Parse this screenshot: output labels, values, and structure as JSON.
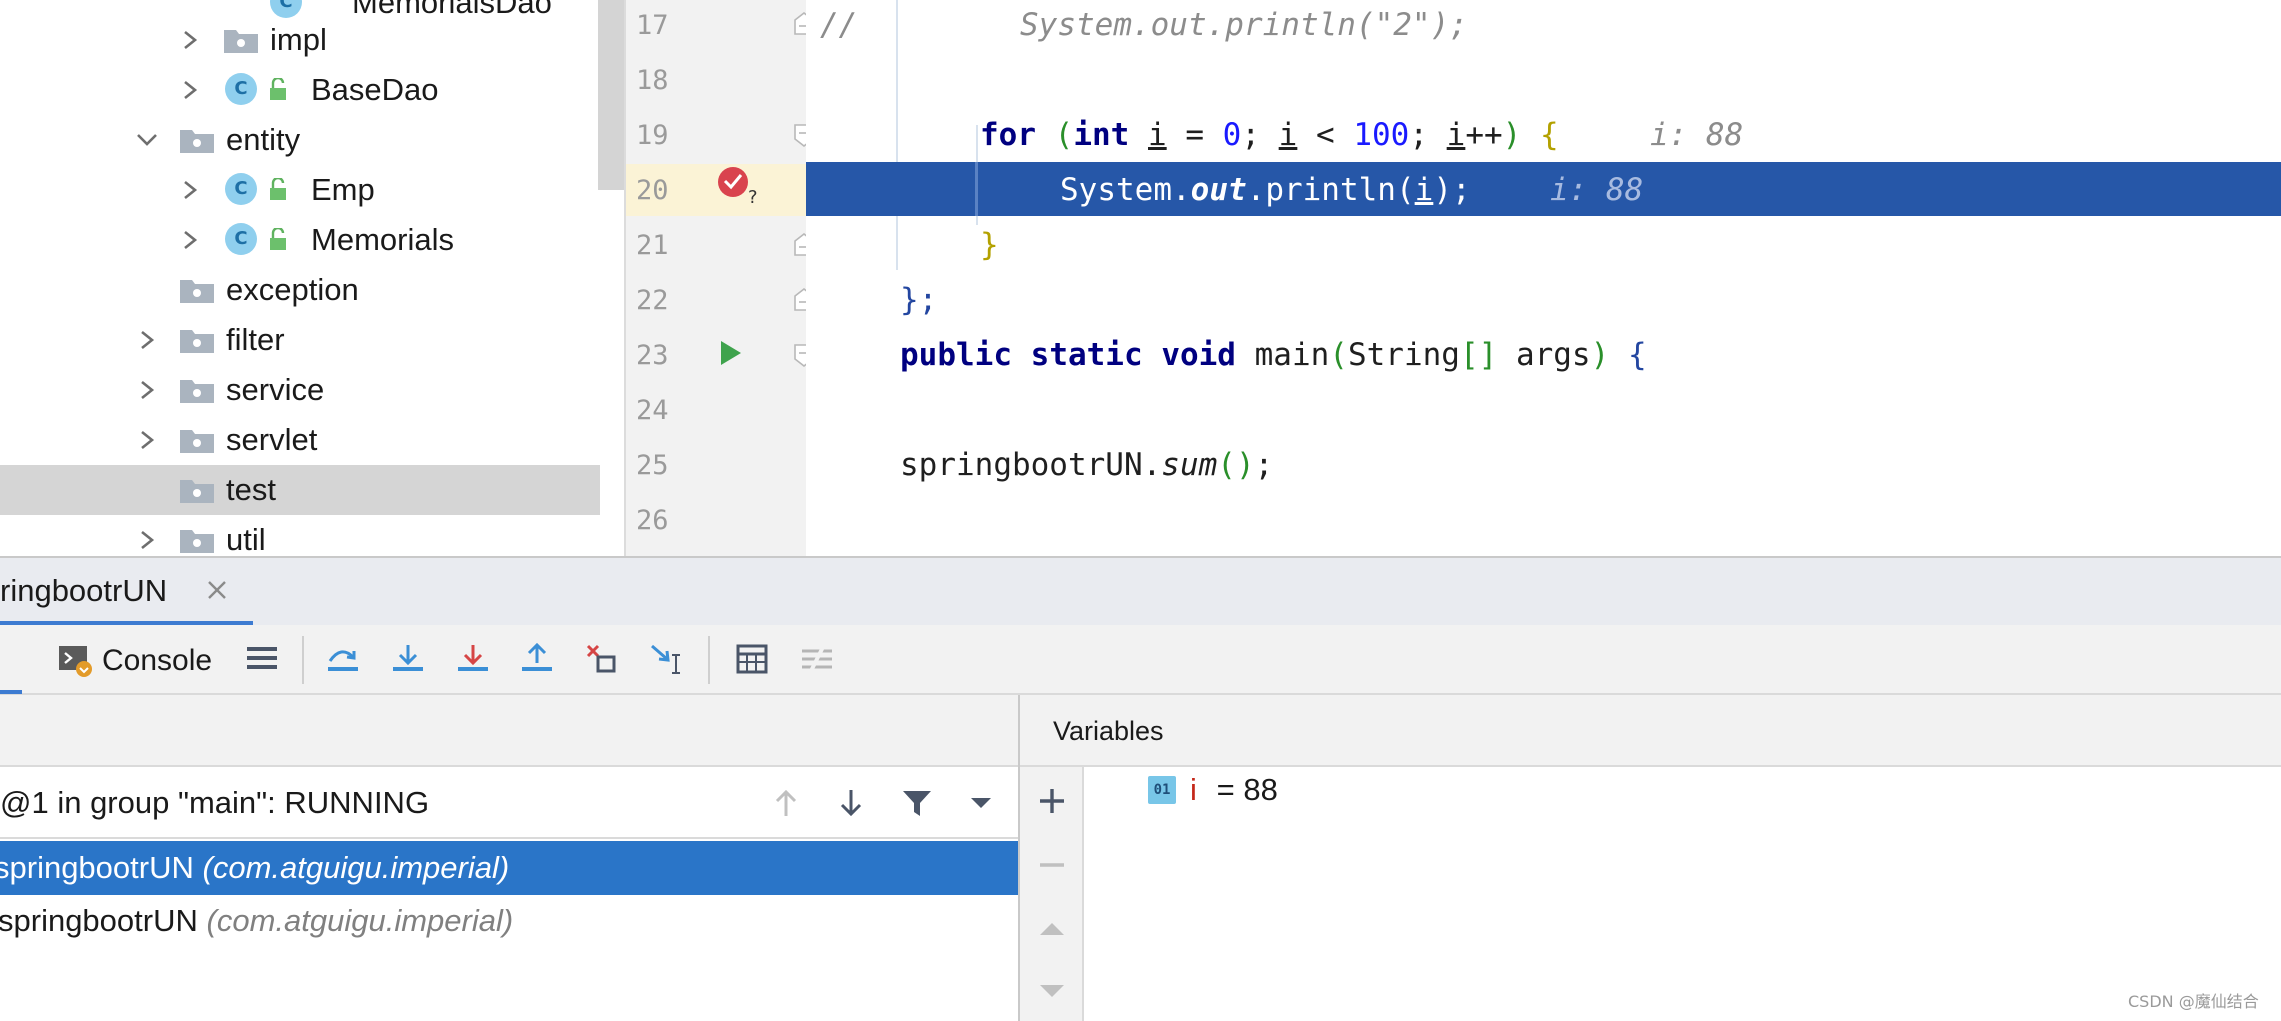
{
  "project_tree": {
    "items": [
      {
        "label": "MemorialsDao",
        "kind": "class",
        "expandable": false
      },
      {
        "label": "impl",
        "kind": "folder",
        "expandable": true
      },
      {
        "label": "BaseDao",
        "kind": "class",
        "expandable": true
      },
      {
        "label": "entity",
        "kind": "folder",
        "expandable": true,
        "expanded": true
      },
      {
        "label": "Emp",
        "kind": "class",
        "expandable": true
      },
      {
        "label": "Memorials",
        "kind": "class",
        "expandable": true
      },
      {
        "label": "exception",
        "kind": "folder",
        "expandable": false
      },
      {
        "label": "filter",
        "kind": "folder",
        "expandable": true
      },
      {
        "label": "service",
        "kind": "folder",
        "expandable": true
      },
      {
        "label": "servlet",
        "kind": "folder",
        "expandable": true
      },
      {
        "label": "test",
        "kind": "folder",
        "expandable": false,
        "selected": true
      },
      {
        "label": "util",
        "kind": "folder",
        "expandable": true
      }
    ],
    "class_badge": "C"
  },
  "editor": {
    "line_numbers": [
      "17",
      "18",
      "19",
      "20",
      "21",
      "22",
      "23",
      "24",
      "25",
      "26"
    ],
    "current_line": "20",
    "lines": {
      "l17_comment_mark": "//",
      "l17_code": "System.out.println(\"2\");",
      "l19_for": "for",
      "l19_open": " (",
      "l19_int": "int",
      "l19_i1": "i",
      "l19_eq": " = ",
      "l19_zero": "0",
      "l19_semi1": "; ",
      "l19_i2": "i",
      "l19_lt": " < ",
      "l19_hundred": "100",
      "l19_semi2": "; ",
      "l19_i3": "i",
      "l19_inc": "++",
      "l19_close": ") ",
      "l19_brace": "{",
      "l19_hint": "i: 88",
      "l20_system": "System.",
      "l20_out": "out",
      "l20_println": ".println(",
      "l20_i": "i",
      "l20_end": ");",
      "l20_hint": "i: 88",
      "l21_brace": "}",
      "l22_code": "};",
      "l23_public": "public",
      "l23_static": "static",
      "l23_void": "void",
      "l23_main": "main",
      "l23_paren_open": "(",
      "l23_string": "String",
      "l23_arr": "[]",
      "l23_args": " args",
      "l23_paren_close": ")",
      "l23_brace": "{",
      "l25_obj": "springbootrUN.",
      "l25_sum": "sum",
      "l25_parens": "()",
      "l25_semi": ";"
    }
  },
  "debug": {
    "tab_label": "ringbootrUN",
    "console_label": "Console",
    "thread_label": "@1 in group \"main\": RUNNING",
    "frames": [
      {
        "name": "springbootrUN",
        "package": "(com.atguigu.imperial)",
        "selected": true
      },
      {
        "name": "springbootrUN",
        "package": "(com.atguigu.imperial)",
        "selected": false
      }
    ],
    "variables_title": "Variables",
    "variables": [
      {
        "type_badge": "01",
        "name": "i",
        "value": " = 88"
      }
    ]
  },
  "watermark": "CSDN @魔仙结合",
  "colors": {
    "execution_line": "#2657a8",
    "selected_frame": "#2a75c8",
    "keyword": "#000080",
    "number": "#1a1aff",
    "breakpoint": "#d9434e",
    "run_arrow": "#3fa34d"
  },
  "icons": {
    "breakpoint": "breakpoint-check-icon",
    "run": "run-gutter-icon",
    "console": "console-icon"
  }
}
